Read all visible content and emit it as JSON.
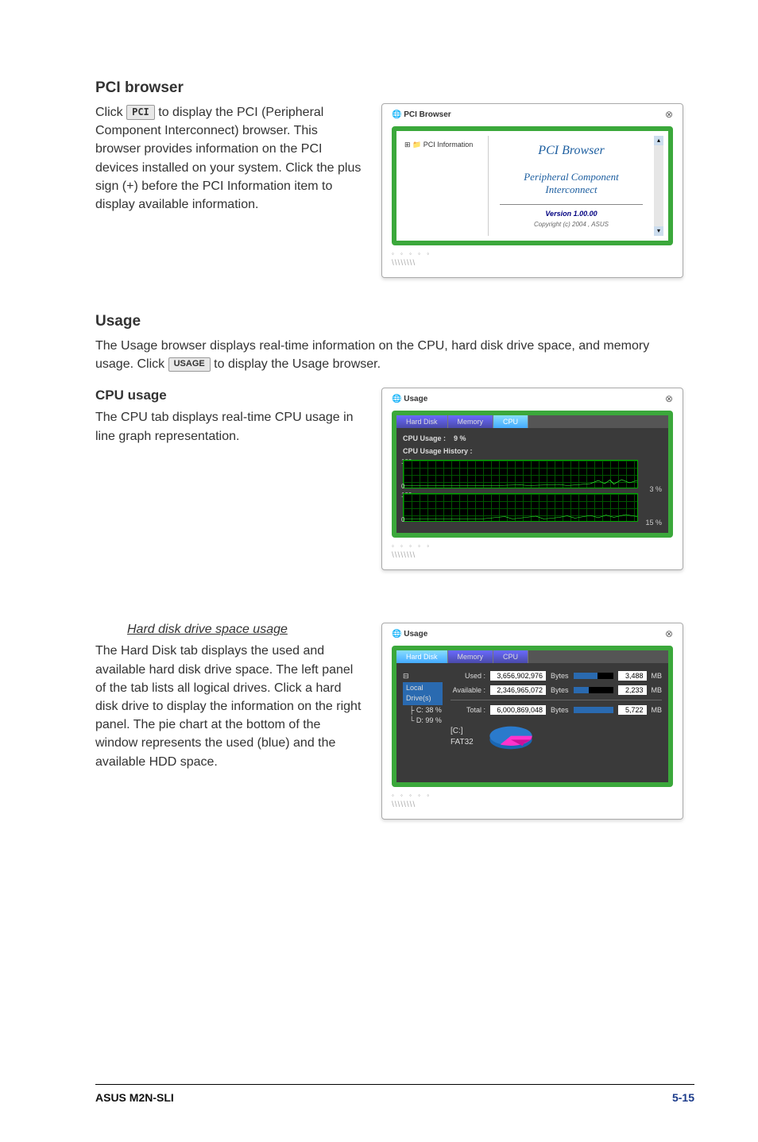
{
  "pci_section": {
    "heading": "PCI browser",
    "click_pre": "Click ",
    "button_label": "PCI",
    "body": " to display the PCI (Peripheral Component Interconnect) browser. This browser provides information on the PCI devices installed on your system. Click the plus sign (+) before the PCI Information item to display available information."
  },
  "pci_window": {
    "title": "PCI Browser",
    "tree_item": "PCI Information",
    "app_title": "PCI Browser",
    "app_sub_1": "Peripheral Component",
    "app_sub_2": "Interconnect",
    "version": "Version 1.00.00",
    "copyright": "Copyright (c) 2004 , ASUS"
  },
  "usage_section": {
    "heading": "Usage",
    "intro_pre": "The Usage browser displays real-time information on the CPU, hard disk drive space, and memory usage. Click ",
    "button_label": "USAGE",
    "intro_post": " to display the Usage browser."
  },
  "cpu_section": {
    "heading": "CPU usage",
    "body": "The CPU tab displays real-time CPU usage in line graph representation."
  },
  "cpu_window": {
    "title": "Usage",
    "tabs": {
      "hard_disk": "Hard Disk",
      "memory": "Memory",
      "cpu": "CPU"
    },
    "cpu_usage_label": "CPU Usage :",
    "cpu_usage_value": "9 %",
    "history_label": "CPU Usage History :",
    "graph1_percent": "3 %",
    "graph2_percent": "15 %",
    "y_top": "100",
    "y_bottom": "0"
  },
  "hdd_section": {
    "link_title": "Hard disk drive space usage",
    "body": "The Hard Disk tab displays the used and available hard disk drive space. The left panel of the tab lists all logical drives. Click a hard disk drive to display the information on the right panel. The pie chart at the bottom of the window represents the used (blue) and the available HDD space."
  },
  "hdd_window": {
    "title": "Usage",
    "tabs": {
      "hard_disk": "Hard Disk",
      "memory": "Memory",
      "cpu": "CPU"
    },
    "tree_root": "Local Drive(s)",
    "tree_c": "C: 38 %",
    "tree_d": "D: 99 %",
    "used_label": "Used :",
    "used_bytes": "3,656,902,976",
    "used_mb": "3,488",
    "avail_label": "Available :",
    "avail_bytes": "2,346,965,072",
    "avail_mb": "2,233",
    "total_label": "Total :",
    "total_bytes": "6,000,869,048",
    "total_mb": "5,722",
    "bytes_unit": "Bytes",
    "mb_unit": "MB",
    "pie_label_1": "[C:]",
    "pie_label_2": "FAT32"
  },
  "chart_data": [
    {
      "type": "line",
      "title": "CPU Usage History (core 1)",
      "ylim": [
        0,
        100
      ],
      "current_value": 3,
      "unit": "%"
    },
    {
      "type": "line",
      "title": "CPU Usage History (core 2)",
      "ylim": [
        0,
        100
      ],
      "current_value": 15,
      "unit": "%"
    },
    {
      "type": "pie",
      "title": "[C:] FAT32 disk usage",
      "series": [
        {
          "name": "Used",
          "value": 3656902976,
          "mb": 3488,
          "percent": 61
        },
        {
          "name": "Available",
          "value": 2346965072,
          "mb": 2233,
          "percent": 39
        }
      ],
      "total_bytes": 6000869048,
      "total_mb": 5722
    }
  ],
  "footer": {
    "product": "ASUS M2N-SLI",
    "page": "5-15"
  }
}
